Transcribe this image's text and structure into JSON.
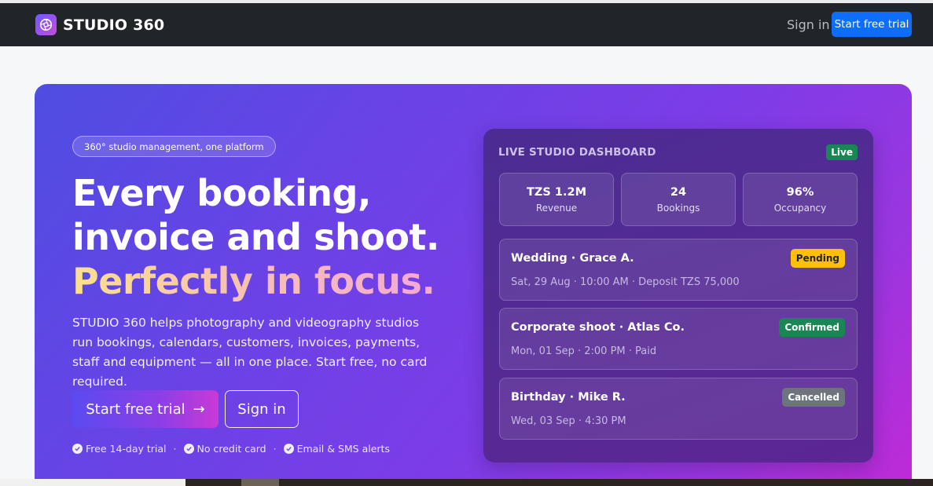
{
  "navbar": {
    "brand": "STUDIO 360",
    "sign_in": "Sign in",
    "cta": "Start free trial"
  },
  "hero": {
    "pill": "360° studio management, one platform",
    "headline_line1": "Every booking,",
    "headline_line2": "invoice and shoot.",
    "headline_line3": "Perfectly in focus.",
    "lead": "STUDIO 360 helps photography and videography studios run bookings, calendars, customers, invoices, payments, staff and equipment — all in one place. Start free, no card required.",
    "primary_cta": "Start free trial",
    "primary_cta_arrow": "→",
    "secondary_cta": "Sign in",
    "features": [
      "Free 14-day trial",
      "No credit card",
      "Email & SMS alerts"
    ],
    "feature_separator": "·"
  },
  "dashboard": {
    "title": "LIVE STUDIO DASHBOARD",
    "live_badge": "Live",
    "stats": [
      {
        "value": "TZS 1.2M",
        "label": "Revenue"
      },
      {
        "value": "24",
        "label": "Bookings"
      },
      {
        "value": "96%",
        "label": "Occupancy"
      }
    ],
    "bookings": [
      {
        "title": "Wedding · Grace A.",
        "detail": "Sat, 29 Aug · 10:00 AM · Deposit TZS 75,000",
        "status": "Pending",
        "status_color": "#ffc107",
        "status_text_color": "#212529"
      },
      {
        "title": "Corporate shoot · Atlas Co.",
        "detail": "Mon, 01 Sep · 2:00 PM · Paid",
        "status": "Confirmed",
        "status_color": "#198754",
        "status_text_color": "#ffffff"
      },
      {
        "title": "Birthday · Mike R.",
        "detail": "Wed, 03 Sep · 4:30 PM",
        "status": "Cancelled",
        "status_color": "#6c757d",
        "status_text_color": "#ffffff"
      }
    ]
  },
  "icons": {
    "brand_logo": "aperture-icon",
    "arrow": "arrow-right-icon",
    "check": "check-circle-icon"
  },
  "colors": {
    "navbar_bg": "#212529",
    "cta_blue": "#0d6efd",
    "hero_start": "#4f4de2",
    "hero_end": "#c02ad6"
  }
}
